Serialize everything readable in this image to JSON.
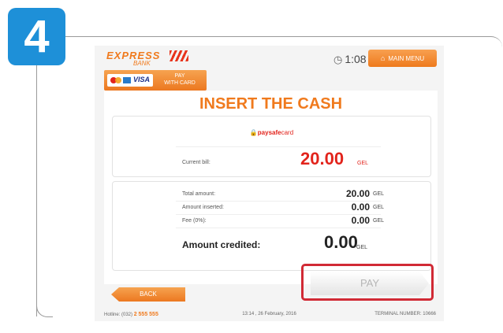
{
  "step_number": "4",
  "header": {
    "logo_main": "EXPRESS",
    "logo_sub": "BANK",
    "timer_icon": "clock-icon",
    "timer": "1:08",
    "main_menu_icon": "home-icon",
    "main_menu_label": "MAIN MENU"
  },
  "card_button": {
    "label_line1": "PAY",
    "label_line2": "WITH CARD",
    "visa": "VISA"
  },
  "panel": {
    "title": "INSERT THE CASH",
    "provider_a": "paysafe",
    "provider_b": "card",
    "current_bill_label": "Current bill:",
    "current_bill_value": "20.00",
    "currency": "GEL",
    "rows": [
      {
        "label": "Total amount:",
        "value": "20.00",
        "currency": "GEL"
      },
      {
        "label": "Amount inserted:",
        "value": "0.00",
        "currency": "GEL"
      },
      {
        "label": "Fee (0%):",
        "value": "0.00",
        "currency": "GEL"
      }
    ],
    "credited_label": "Amount credited:",
    "credited_value": "0.00",
    "credited_currency": "GEL"
  },
  "buttons": {
    "back": "BACK",
    "pay": "PAY"
  },
  "footer": {
    "hotline_label": "Hotline: (032)",
    "hotline_number": "2 555 555",
    "datetime": "13:14 , 26 February, 2016",
    "terminal": "TERMINAL NUMBER: 10666"
  },
  "colors": {
    "accent": "#f07a1d",
    "badge": "#1e90d8",
    "highlight": "#d12a35",
    "amount_red": "#e2241c"
  }
}
